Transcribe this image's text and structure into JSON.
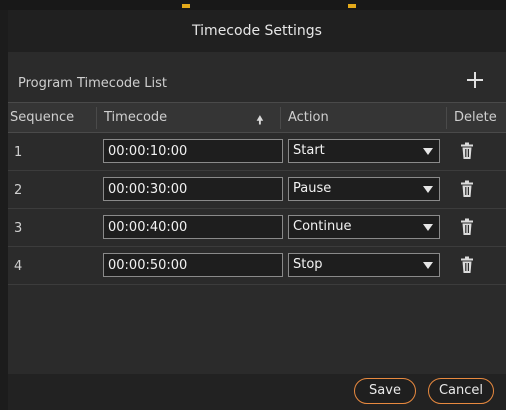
{
  "dialog": {
    "title": "Timecode Settings"
  },
  "section": {
    "title": "Program Timecode List"
  },
  "table": {
    "headers": {
      "sequence": "Sequence",
      "timecode": "Timecode",
      "action": "Action",
      "delete": "Delete"
    },
    "rows": [
      {
        "sequence": "1",
        "timecode": "00:00:10:00",
        "action": "Start"
      },
      {
        "sequence": "2",
        "timecode": "00:00:30:00",
        "action": "Pause"
      },
      {
        "sequence": "3",
        "timecode": "00:00:40:00",
        "action": "Continue"
      },
      {
        "sequence": "4",
        "timecode": "00:00:50:00",
        "action": "Stop"
      }
    ]
  },
  "footer": {
    "save_label": "Save",
    "cancel_label": "Cancel"
  },
  "colors": {
    "accent": "#e7893f",
    "marker": "#e3a91a"
  },
  "icons": {
    "add": "plus-icon",
    "sort": "arrow-up-icon",
    "delete": "trash-icon",
    "dropdown": "chevron-down-icon"
  }
}
